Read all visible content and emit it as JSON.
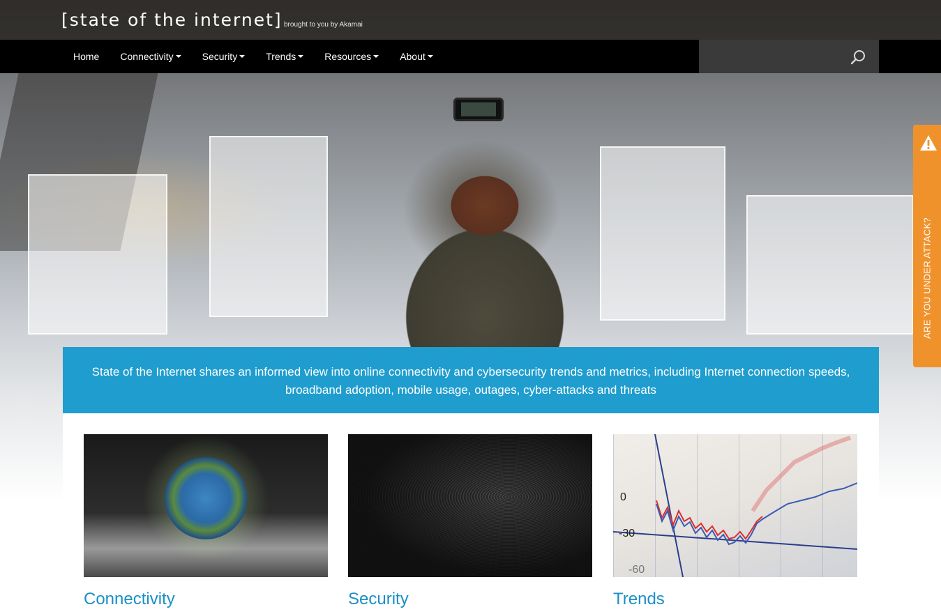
{
  "header": {
    "site_title": "[state of the internet]",
    "tagline": "brought to you by Akamai"
  },
  "nav": {
    "items": [
      {
        "label": "Home",
        "dropdown": false
      },
      {
        "label": "Connectivity",
        "dropdown": true
      },
      {
        "label": "Security",
        "dropdown": true
      },
      {
        "label": "Trends",
        "dropdown": true
      },
      {
        "label": "Resources",
        "dropdown": true
      },
      {
        "label": "About",
        "dropdown": true
      }
    ],
    "search": {
      "value": "",
      "placeholder": ""
    }
  },
  "side_tab": {
    "label": "ARE YOU UNDER ATTACK?",
    "icon": "warning-icon",
    "color": "#f0922b"
  },
  "intro": {
    "text": "State of the Internet shares an informed view into online connectivity and cybersecurity trends and metrics, including Internet connection speeds, broadband adoption, mobile usage, outages, cyber-attacks and threats"
  },
  "cards": [
    {
      "title": "Connectivity",
      "image": "earth-in-hand-image"
    },
    {
      "title": "Security",
      "image": "fingerprint-image"
    },
    {
      "title": "Trends",
      "image": "stock-chart-image",
      "chart_labels": [
        "0",
        "-30",
        "-60"
      ]
    }
  ],
  "colors": {
    "accent": "#1e9dce",
    "link": "#1a8fc6",
    "nav_bg": "#000000",
    "tab": "#f0922b"
  }
}
